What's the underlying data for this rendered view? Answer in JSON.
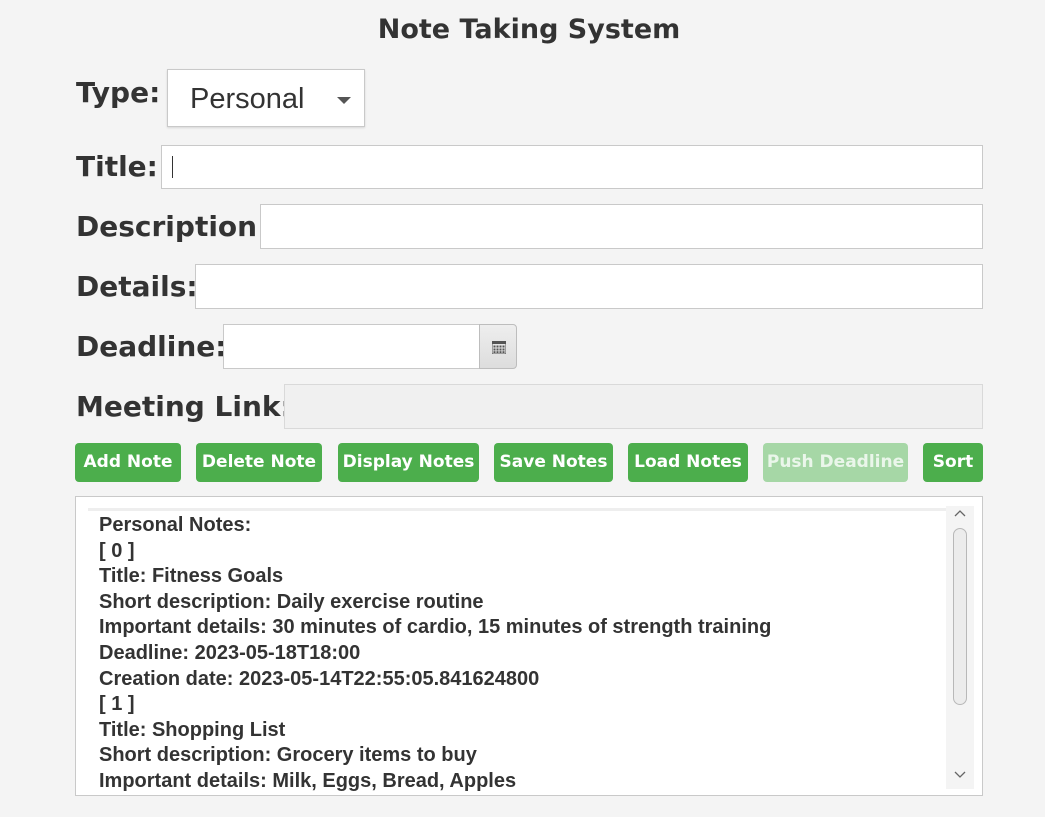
{
  "app": {
    "title": "Note Taking System"
  },
  "form": {
    "type_label": "Type:",
    "type_value": "Personal",
    "title_label": "Title:",
    "title_value": "",
    "description_label": "Description:",
    "description_value": "",
    "details_label": "Details:",
    "details_value": "",
    "deadline_label": "Deadline:",
    "deadline_value": "",
    "meeting_link_label": "Meeting Link:",
    "meeting_link_value": ""
  },
  "buttons": {
    "add_note": "Add Note",
    "delete_note": "Delete Note",
    "display_notes": "Display Notes",
    "save_notes": "Save Notes",
    "load_notes": "Load Notes",
    "push_deadline": "Push Deadline",
    "sort": "Sort"
  },
  "output": {
    "lines": [
      "Personal Notes:",
      "[ 0 ]",
      "Title: Fitness Goals",
      "Short description: Daily exercise routine",
      "Important details: 30 minutes of cardio, 15 minutes of strength training",
      "Deadline: 2023-05-18T18:00",
      "Creation date: 2023-05-14T22:55:05.841624800",
      "[ 1 ]",
      "Title: Shopping List",
      "Short description: Grocery items to buy",
      "Important details: Milk, Eggs, Bread, Apples"
    ]
  },
  "icons": {
    "type_dropdown": "chevron-down-icon",
    "deadline_picker": "calendar-icon",
    "scroll_up": "chevron-up-icon",
    "scroll_down": "chevron-down-icon"
  },
  "colors": {
    "button_green": "#4cae4c",
    "button_disabled": "#a6d7a6",
    "text": "#333333",
    "background": "#f4f4f4"
  }
}
